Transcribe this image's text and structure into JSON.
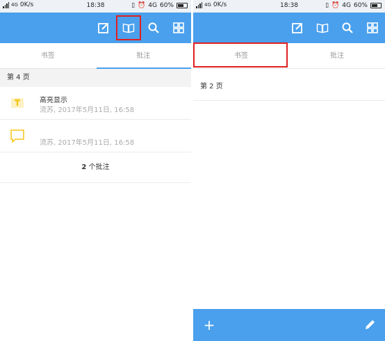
{
  "left": {
    "status": {
      "net_left": "4G",
      "net_left2": "G",
      "speed": "0K/s",
      "time": "18:38",
      "net_right": "4G",
      "battery": "60%"
    },
    "tabs": [
      "书签",
      "批注"
    ],
    "active_tab": 1,
    "page_header": "第 4 页",
    "annotations": [
      {
        "type": "highlight",
        "title": "高亮显示",
        "meta": "流苏, 2017年5月11日, 16:58"
      },
      {
        "type": "note",
        "title": "",
        "meta": "流苏, 2017年5月11日, 16:58"
      }
    ],
    "count_number": "2",
    "count_suffix": " 个批注"
  },
  "right": {
    "status": {
      "net_left": "4G",
      "net_left2": "G",
      "speed": "0K/s",
      "time": "18:38",
      "net_right": "4G",
      "battery": "60%"
    },
    "tabs": [
      "书签",
      "批注"
    ],
    "active_tab": 0,
    "bookmark_row": "第 2 页",
    "bottom": {
      "add_icon": "+"
    }
  },
  "icons": [
    "edit-note-icon",
    "book-icon",
    "search-icon",
    "grid-icon",
    "pencil-icon"
  ],
  "colors": {
    "accent": "#4aa0ec",
    "highlight": "#e02020",
    "note_yellow": "#f5c518"
  }
}
